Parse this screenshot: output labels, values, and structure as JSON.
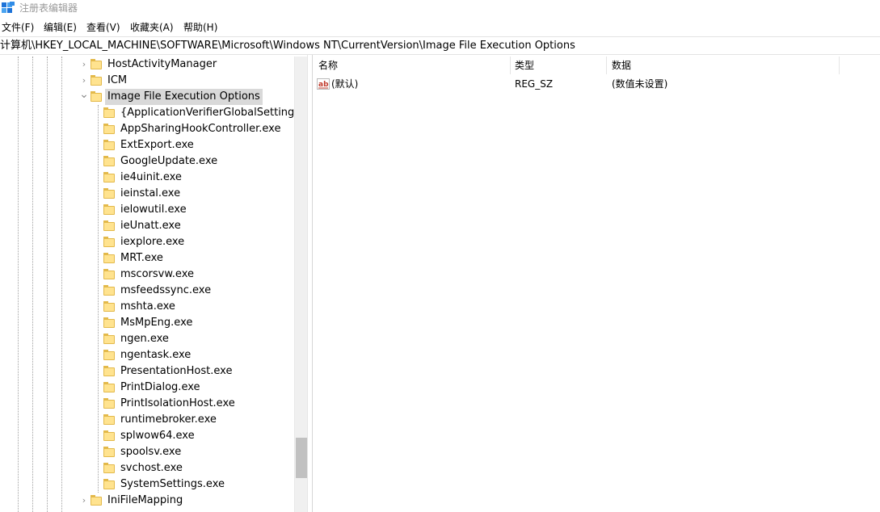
{
  "window": {
    "title": "注册表编辑器"
  },
  "menu": [
    "文件(F)",
    "编辑(E)",
    "查看(V)",
    "收藏夹(A)",
    "帮助(H)"
  ],
  "address": "计算机\\HKEY_LOCAL_MACHINE\\SOFTWARE\\Microsoft\\Windows NT\\CurrentVersion\\Image File Execution Options",
  "tree": {
    "parents": [
      {
        "label": "HostActivityManager",
        "expander": "collapsed"
      },
      {
        "label": "ICM",
        "expander": "collapsed"
      },
      {
        "label": "Image File Execution Options",
        "expander": "expanded",
        "selected": true
      }
    ],
    "children": [
      "{ApplicationVerifierGlobalSettings}",
      "AppSharingHookController.exe",
      "ExtExport.exe",
      "GoogleUpdate.exe",
      "ie4uinit.exe",
      "ieinstal.exe",
      "ielowutil.exe",
      "ieUnatt.exe",
      "iexplore.exe",
      "MRT.exe",
      "mscorsvw.exe",
      "msfeedssync.exe",
      "mshta.exe",
      "MsMpEng.exe",
      "ngen.exe",
      "ngentask.exe",
      "PresentationHost.exe",
      "PrintDialog.exe",
      "PrintIsolationHost.exe",
      "runtimebroker.exe",
      "splwow64.exe",
      "spoolsv.exe",
      "svchost.exe",
      "SystemSettings.exe"
    ],
    "after": [
      {
        "label": "IniFileMapping",
        "expander": "collapsed"
      }
    ]
  },
  "list": {
    "columns": [
      "名称",
      "类型",
      "数据"
    ],
    "rows": [
      {
        "name": "(默认)",
        "type": "REG_SZ",
        "data": "(数值未设置)",
        "icon": "string-value-icon"
      }
    ]
  },
  "colors": {
    "folder": "#ffe38f",
    "selection": "#d9d9d9",
    "ab_icon": "#c0392b"
  }
}
